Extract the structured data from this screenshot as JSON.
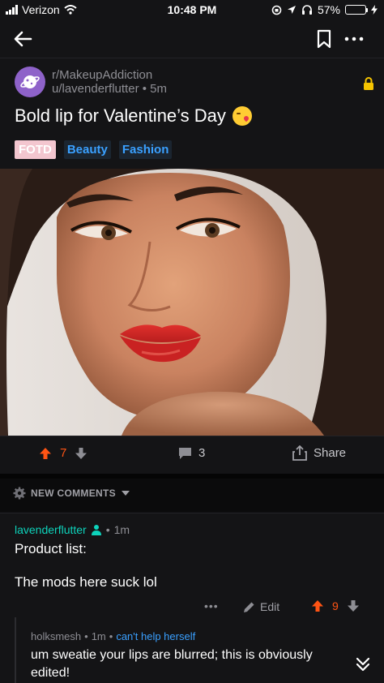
{
  "status_bar": {
    "carrier": "Verizon",
    "time": "10:48 PM",
    "battery_percent": "57%",
    "battery_level": 0.57
  },
  "nav": {
    "back_icon": "arrow-left-icon",
    "bookmark_icon": "bookmark-icon",
    "more_icon": "more-horizontal-icon"
  },
  "post": {
    "subreddit": "r/MakeupAddiction",
    "author": "u/lavenderflutter",
    "age": "5m",
    "title": "Bold lip for Valentine’s Day",
    "flairs": [
      "FOTD",
      "Beauty",
      "Fashion"
    ]
  },
  "actions": {
    "vote_count": "7",
    "comment_count": "3",
    "share_label": "Share"
  },
  "sort": {
    "label": "NEW COMMENTS"
  },
  "comment": {
    "author": "lavenderflutter",
    "age": "1m",
    "body_line1": "Product list:",
    "body_line2": "The mods here suck lol",
    "more_label": "•••",
    "edit_label": "Edit",
    "vote_count": "9"
  },
  "reply": {
    "author": "holksmesh",
    "age": "1m",
    "flair": "can't help herself",
    "body": "um sweatie your lips are blurred; this is obviously edited!"
  },
  "colors": {
    "upvote": "#ff5414",
    "link": "#3aa0ff",
    "op_author": "#0dd3bb",
    "fotd_flair_bg": "#f3c6cf"
  }
}
